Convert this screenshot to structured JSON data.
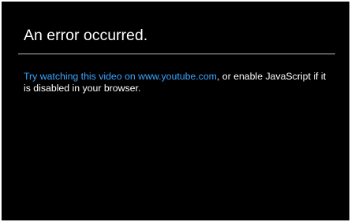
{
  "error": {
    "title": "An error occurred.",
    "link_text": "Try watching this video on www.youtube.com",
    "message_rest": ", or enable JavaScript if it is disabled in your browser."
  },
  "colors": {
    "background": "#000000",
    "text": "#ffffff",
    "link": "#3ea6ff",
    "divider": "#bdbdbd"
  }
}
